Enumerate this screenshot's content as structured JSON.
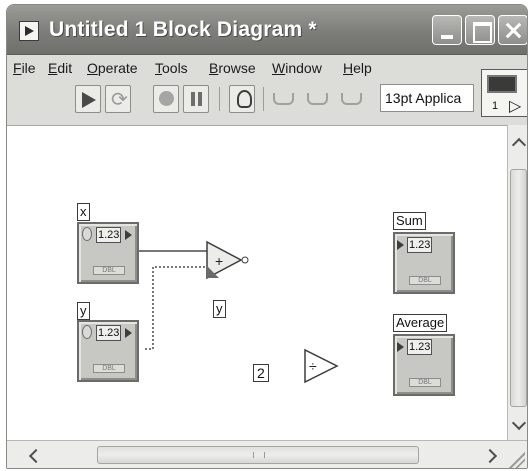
{
  "window": {
    "title": "Untitled 1 Block Diagram *"
  },
  "menu": {
    "items": [
      "File",
      "Edit",
      "Operate",
      "Tools",
      "Browse",
      "Window",
      "Help"
    ]
  },
  "toolbar": {
    "font_value": "13pt Applica"
  },
  "panel_icon": {
    "connector_number": "1"
  },
  "diagram": {
    "controls": [
      {
        "label": "x",
        "value": "1.23",
        "type_text": "DBL"
      },
      {
        "label": "y",
        "value": "1.23",
        "type_text": "DBL"
      }
    ],
    "indicators": [
      {
        "label": "Sum",
        "value": "1.23",
        "type_text": "DBL"
      },
      {
        "label": "Average",
        "value": "1.23",
        "type_text": "DBL"
      }
    ],
    "tip_label": "y",
    "constant": "2"
  }
}
